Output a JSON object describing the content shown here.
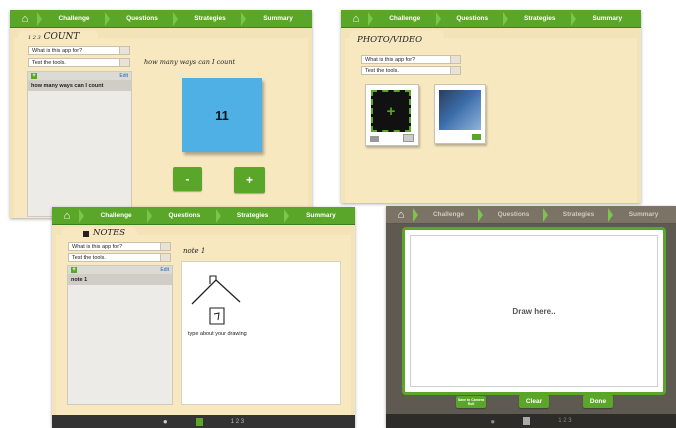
{
  "nav": {
    "tabs": [
      "Challenge",
      "Questions",
      "Strategies",
      "Summary"
    ]
  },
  "fields": {
    "q1": "What is this app for?",
    "q2": "Test the tools."
  },
  "count_screen": {
    "title": "COUNT",
    "title_prefix": "1 2 3",
    "list_edit": "Edit",
    "list_item": "how many ways can I count",
    "prompt": "how many ways can I count",
    "value": "11",
    "minus": "-",
    "plus": "+"
  },
  "photo_screen": {
    "title": "PHOTO/VIDEO",
    "add_symbol": "+"
  },
  "notes_screen": {
    "title": "NOTES",
    "list_edit": "Edit",
    "list_item": "note 1",
    "note_title": "note 1",
    "note_text": "type about your drawing",
    "bottom_count": "1 2 3"
  },
  "draw_screen": {
    "placeholder": "Draw here..",
    "save_label": "Save to Camera Roll",
    "clear_label": "Clear",
    "done_label": "Done",
    "bottom_count": "1 2 3"
  },
  "colors": {
    "nav_green": "#5aa628",
    "folder": "#f7e8c0",
    "sticky_blue": "#4fb0e6"
  }
}
